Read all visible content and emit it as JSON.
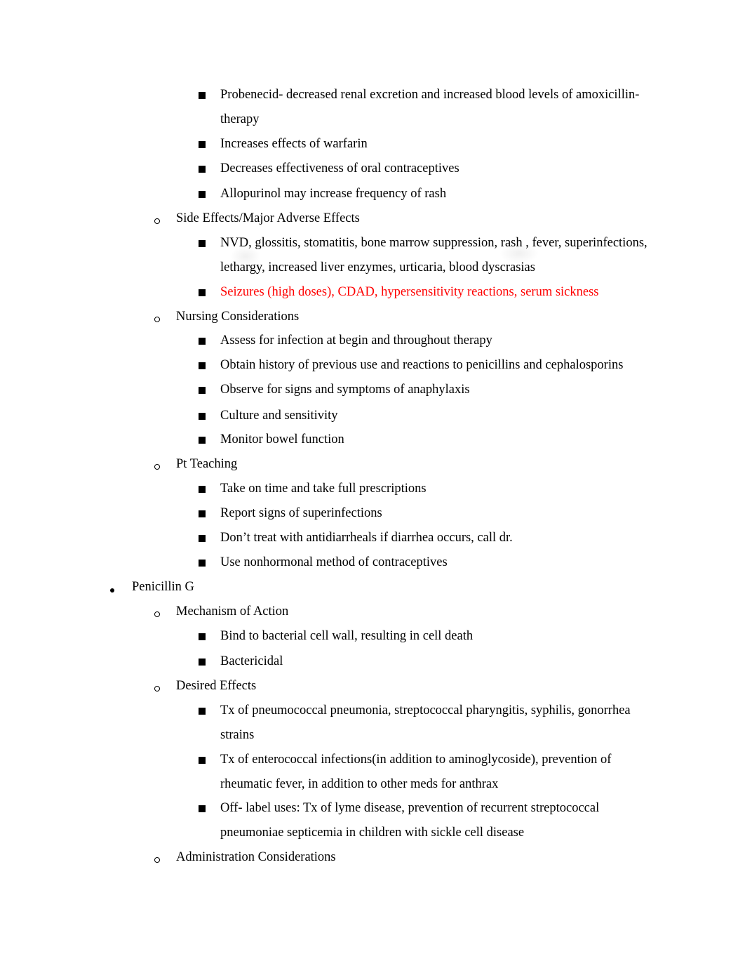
{
  "document": {
    "sections": [
      {
        "items": [
          {
            "text": "Probenecid- decreased renal excretion and increased blood levels of amoxicillin-"
          },
          {
            "text": "therapy"
          },
          {
            "text": "Increases effects of warfarin"
          },
          {
            "text": "Decreases effectiveness of oral contraceptives"
          },
          {
            "text": "Allopurinol may increase frequency of rash"
          }
        ]
      },
      {
        "heading": "Side Effects/Major Adverse Effects",
        "items": [
          {
            "line1": "NVD, glossitis, stomatitis, bone marrow suppression, rash , fever, superinfections,",
            "line2": "lethargy, increased liver enzymes, urticaria, blood dyscrasias"
          },
          {
            "text": "Seizures (high doses), CDAD, hypersensitivity reactions, serum sickness",
            "color": "#ff0000"
          }
        ]
      },
      {
        "heading": "Nursing Considerations",
        "items": [
          "Assess for infection at begin and throughout therapy",
          "Obtain history of previous use and reactions to penicillins and cephalosporins",
          "Observe for signs and symptoms of anaphylaxis",
          "Culture and sensitivity",
          "Monitor bowel function"
        ]
      },
      {
        "heading": "Pt Teaching",
        "items": [
          "Take on time and take full prescriptions",
          "Report signs of superinfections",
          "Don’t treat with antidiarrheals if diarrhea occurs, call dr.",
          "Use nonhormonal method of contraceptives"
        ]
      }
    ],
    "drug": {
      "name": "Penicillin G",
      "mechanism": {
        "heading": "Mechanism of Action",
        "items": [
          "Bind to bacterial cell wall, resulting in cell death",
          "Bactericidal"
        ]
      },
      "desired_effects": {
        "heading": "Desired Effects",
        "items": [
          {
            "line1": "Tx of pneumococcal pneumonia, streptococcal pharyngitis, syphilis, gonorrhea",
            "line2": "strains"
          },
          {
            "line1": "Tx of enterococcal infections(in addition to aminoglycoside), prevention of",
            "line2": "rheumatic fever, in addition to other meds for anthrax"
          },
          {
            "line1": "Off- label uses: Tx of lyme disease, prevention of recurrent streptococcal",
            "line2": "pneumoniae septicemia in children with sickle cell disease"
          }
        ]
      },
      "administration": {
        "heading": "Administration Considerations"
      }
    }
  }
}
